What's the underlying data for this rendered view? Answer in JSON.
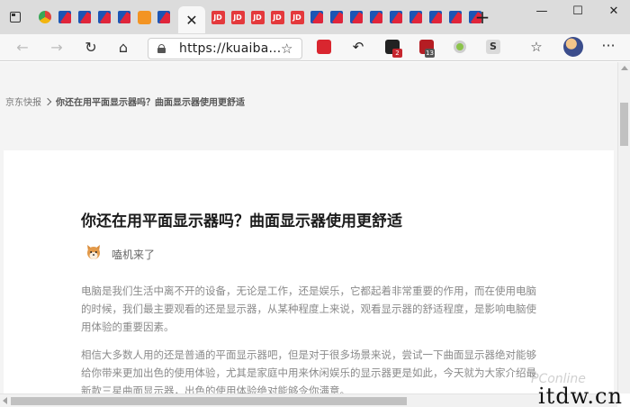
{
  "tabs": {
    "favicons": [
      "tab-actions",
      "chrome",
      "brand-m",
      "brand-m",
      "brand-m",
      "brand-m",
      "orange",
      "brand-m"
    ],
    "active_tab_close_glyph": "✕",
    "after_active": [
      "jd",
      "jd",
      "jd",
      "jd",
      "jd",
      "brand-m",
      "brand-m",
      "brand-m",
      "brand-m",
      "brand-m",
      "brand-m",
      "brand-m",
      "brand-m",
      "brand-m"
    ],
    "jd_label": "JD",
    "new_tab_glyph": "+",
    "colors": {
      "brand_blue": "#1c55b4",
      "brand_red": "#e0253a",
      "jd_red": "#e4393c"
    }
  },
  "window": {
    "minimize": "—",
    "maximize": "☐",
    "close": "✕"
  },
  "toolbar": {
    "back_glyph": "←",
    "forward_glyph": "→",
    "reload_glyph": "↻",
    "home_glyph": "⌂",
    "url": "https://kuaiba...",
    "extensions": [
      {
        "icon": "red-bookmark-extension-icon",
        "badge": ""
      },
      {
        "icon": "undo-arrow-extension-icon",
        "badge": ""
      },
      {
        "icon": "black-square-extension-icon",
        "badge": "2"
      },
      {
        "icon": "red-camera-extension-icon",
        "badge": "13"
      },
      {
        "icon": "green-circle-extension-icon",
        "badge": ""
      },
      {
        "icon": "s-extension-icon",
        "badge": ""
      }
    ],
    "extension_s_label": "S",
    "menu_glyph": "···"
  },
  "page": {
    "breadcrumb": {
      "root": "京东快报",
      "current": "你还在用平面显示器吗？曲面显示器使用更舒适"
    },
    "article": {
      "title": "你还在用平面显示器吗？曲面显示器使用更舒适",
      "author": "嗑机来了",
      "paragraphs": [
        "电脑是我们生活中离不开的设备，无论是工作，还是娱乐，它都起着非常重要的作用，而在使用电脑的时候，我们最主要观看的还是显示器，从某种程度上来说，观看显示器的舒适程度，是影响电脑使用体验的重要因素。",
        "相信大多数人用的还是普通的平面显示器吧，但是对于很多场景来说，尝试一下曲面显示器绝对能够给你带来更加出色的使用体验，尤其是家庭中用来休闲娱乐的显示器更是如此，今天就为大家介绍最新款三星曲面显示器，出色的使用体验绝对能够令你满意。"
      ]
    }
  },
  "watermarks": {
    "pconline": "PConline",
    "itdw": "itdw.cn"
  }
}
